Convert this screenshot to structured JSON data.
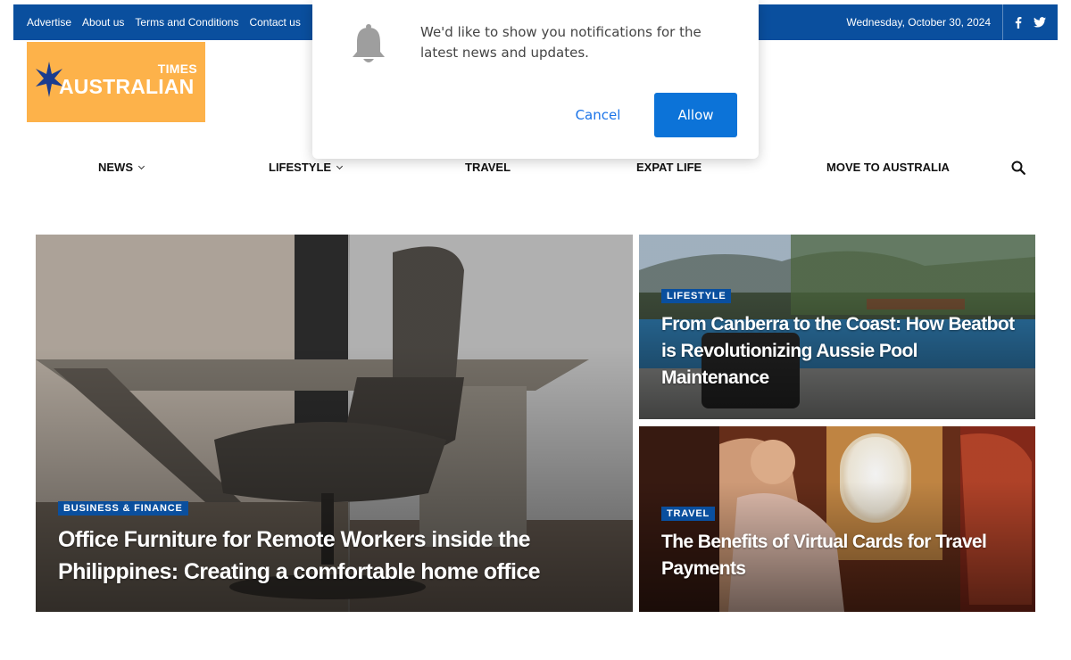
{
  "topbar": {
    "links": [
      "Advertise",
      "About us",
      "Terms and Conditions",
      "Contact us"
    ],
    "date": "Wednesday, October 30, 2024",
    "social": [
      "facebook-icon",
      "twitter-icon"
    ]
  },
  "logo": {
    "times": "TIMES",
    "name": "AUSTRALIAN"
  },
  "nav": {
    "items": [
      {
        "label": "NEWS",
        "has_dropdown": true
      },
      {
        "label": "LIFESTYLE",
        "has_dropdown": true
      },
      {
        "label": "TRAVEL",
        "has_dropdown": false
      },
      {
        "label": "EXPAT LIFE",
        "has_dropdown": false
      },
      {
        "label": "MOVE TO AUSTRALIA",
        "has_dropdown": false
      }
    ]
  },
  "featured": {
    "main": {
      "tag": "BUSINESS & FINANCE",
      "title": "Office Furniture for Remote Workers inside the Philippines: Creating a comfortable home office"
    },
    "side_top": {
      "tag": "LIFESTYLE",
      "title": "From Canberra to the Coast: How Beatbot is Revolutionizing Aussie Pool Maintenance"
    },
    "side_bottom": {
      "tag": "TRAVEL",
      "title": "The Benefits of Virtual Cards for Travel Payments"
    }
  },
  "popup": {
    "message": "We'd like to show you notifications for the latest news and updates.",
    "cancel_label": "Cancel",
    "allow_label": "Allow"
  },
  "colors": {
    "brand_blue": "#0a4f9e",
    "logo_orange": "#fdb24a",
    "allow_blue": "#0c73d8"
  }
}
